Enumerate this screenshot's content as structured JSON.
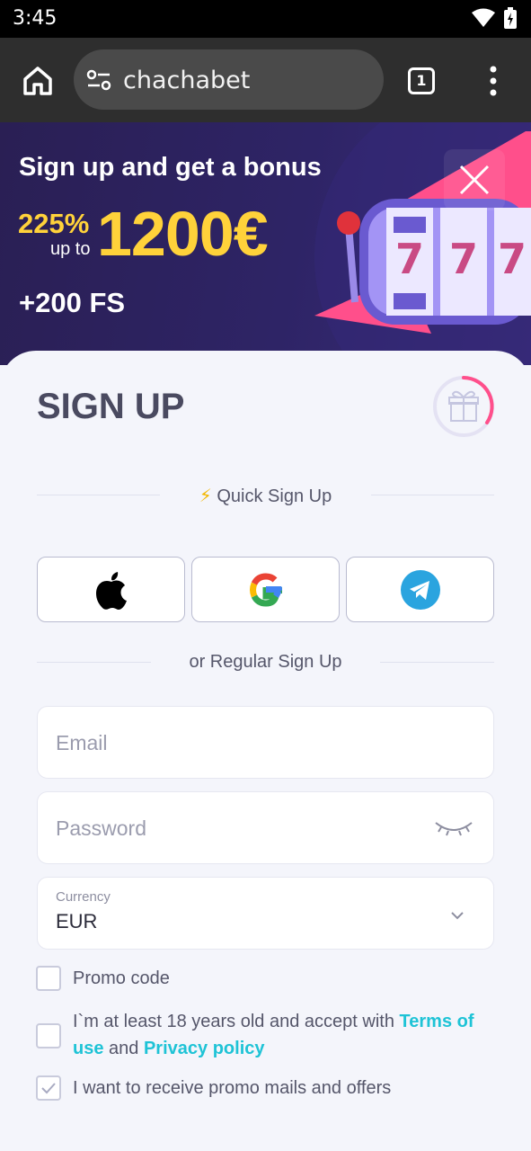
{
  "status": {
    "time": "3:45"
  },
  "browser": {
    "url": "chachabet",
    "tab_count": "1"
  },
  "banner": {
    "title": "Sign up and get a bonus",
    "percent": "225%",
    "up_to": "up to",
    "amount": "1200€",
    "free_spins": "+200 FS"
  },
  "signup": {
    "title": "SIGN UP",
    "quick_label": "Quick Sign Up",
    "regular_label": "or Regular Sign Up",
    "social": [
      "apple",
      "google",
      "telegram"
    ],
    "email_placeholder": "Email",
    "password_placeholder": "Password",
    "currency_label": "Currency",
    "currency_value": "EUR",
    "promo_code_label": "Promo code",
    "age_text": "I`m at least 18 years old and accept with",
    "terms_link": "Terms of use",
    "and_text": "and",
    "privacy_link": "Privacy policy",
    "promo_mails_label": "I want to receive promo mails and offers",
    "promo_mails_checked": true
  },
  "colors": {
    "accent": "#1ec3d6",
    "banner_bg": "#2e2466",
    "gold": "#ffd23a",
    "pink": "#ff4f8b"
  }
}
